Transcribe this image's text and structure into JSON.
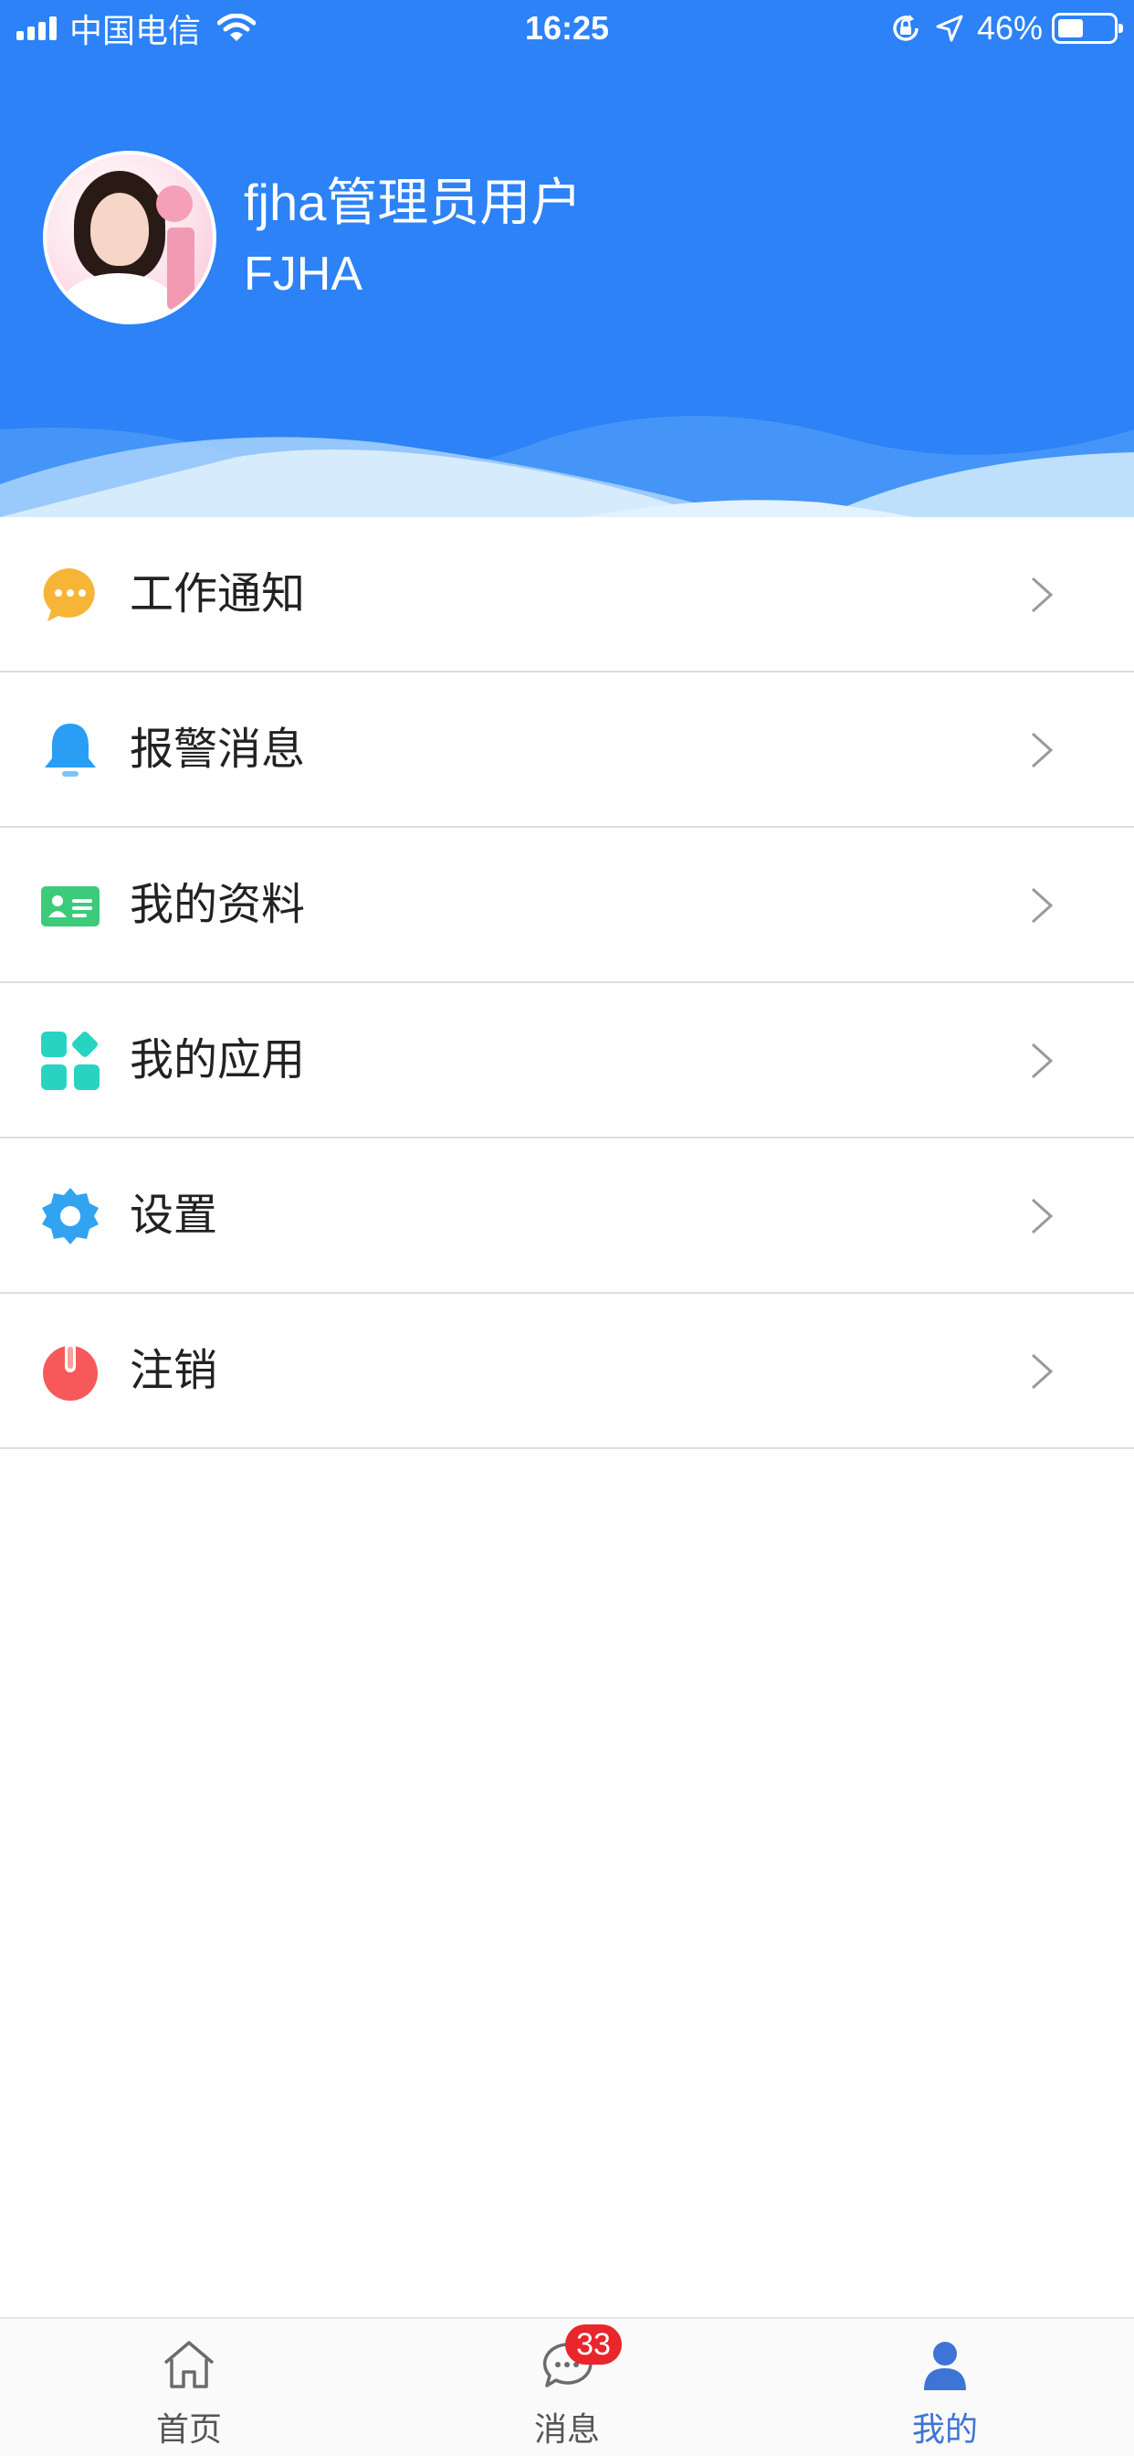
{
  "status_bar": {
    "carrier": "中国电信",
    "time": "16:25",
    "battery_percent": "46%",
    "battery_level": 0.46,
    "icons": [
      "signal-icon",
      "wifi-icon",
      "orientation-lock-icon",
      "location-arrow-icon",
      "battery-icon"
    ]
  },
  "profile": {
    "name": "fjha管理员用户",
    "account": "FJHA"
  },
  "colors": {
    "header_blue": "#2c82f6",
    "notice_orange": "#f7b538",
    "alarm_blue": "#2a9df4",
    "profile_green": "#3ccb7a",
    "apps_teal": "#28d3c1",
    "settings_blue": "#31a3f1",
    "logout_red": "#f7595a",
    "tab_active": "#3d74d6",
    "badge_red": "#e8262c"
  },
  "menu": {
    "items": [
      {
        "label": "工作通知",
        "icon": "chat-bubble-icon"
      },
      {
        "label": "报警消息",
        "icon": "bell-icon"
      },
      {
        "label": "我的资料",
        "icon": "id-card-icon"
      },
      {
        "label": "我的应用",
        "icon": "apps-grid-icon"
      },
      {
        "label": "设置",
        "icon": "gear-icon"
      },
      {
        "label": "注销",
        "icon": "power-icon"
      }
    ]
  },
  "tabbar": {
    "tabs": [
      {
        "label": "首页",
        "icon": "home-icon"
      },
      {
        "label": "消息",
        "icon": "message-icon",
        "badge": "33"
      },
      {
        "label": "我的",
        "icon": "person-icon",
        "active": true
      }
    ]
  }
}
